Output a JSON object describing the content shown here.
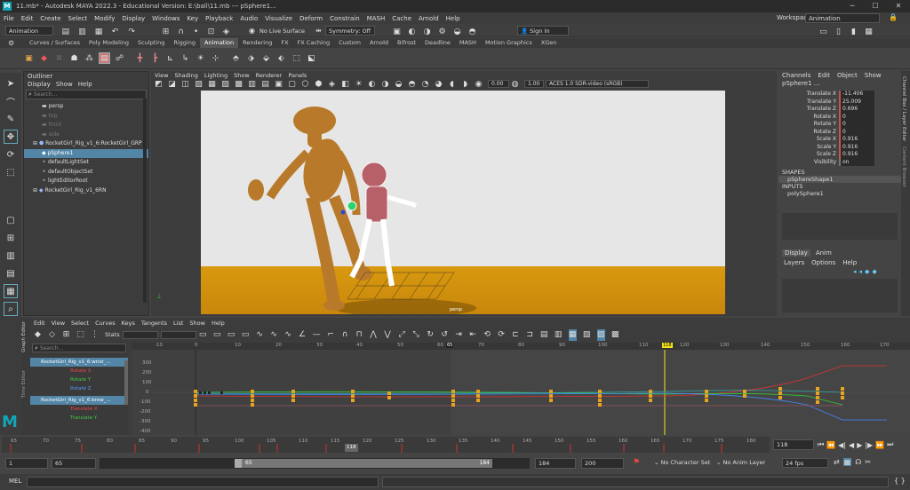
{
  "titlebar": {
    "title": "11.mb* - Autodesk MAYA 2022.3 - Educational Version: E:\\ball\\11.mb  ---  pSphere1...",
    "workspace_label": "Workspace :",
    "workspace_value": "Animation"
  },
  "menubar": {
    "items": [
      "File",
      "Edit",
      "Create",
      "Select",
      "Modify",
      "Display",
      "Windows",
      "Key",
      "Playback",
      "Audio",
      "Visualize",
      "Deform",
      "Constrain",
      "MASH",
      "Cache",
      "Arnold",
      "Help"
    ]
  },
  "statusline": {
    "mode": "Animation",
    "live_surface": "No Live Surface",
    "symmetry": "Symmetry: Off",
    "sign_in": "Sign In"
  },
  "shelf_tabs": {
    "items": [
      "Curves / Surfaces",
      "Poly Modeling",
      "Sculpting",
      "Rigging",
      "Animation",
      "Rendering",
      "FX",
      "FX Caching",
      "Custom",
      "Arnold",
      "Bifrost",
      "Deadline",
      "MASH",
      "Motion Graphics",
      "XGen"
    ],
    "active": "Animation"
  },
  "outliner": {
    "title": "Outliner",
    "menu": [
      "Display",
      "Show",
      "Help"
    ],
    "search_placeholder": "Search...",
    "items": [
      {
        "label": "persp",
        "state": "normal"
      },
      {
        "label": "top",
        "state": "dim"
      },
      {
        "label": "front",
        "state": "dim"
      },
      {
        "label": "side",
        "state": "dim"
      },
      {
        "label": "RocketGirl_Rig_v1_6:RocketGirl_GRP",
        "state": "normal"
      },
      {
        "label": "pSphere1",
        "state": "selected"
      },
      {
        "label": "defaultLightSet",
        "state": "normal"
      },
      {
        "label": "defaultObjectSet",
        "state": "normal"
      },
      {
        "label": "lightEditorRoot",
        "state": "normal"
      },
      {
        "label": "RocketGirl_Rig_v1_6RN",
        "state": "normal"
      }
    ]
  },
  "viewport": {
    "menu": [
      "View",
      "Shading",
      "Lighting",
      "Show",
      "Renderer",
      "Panels"
    ],
    "exposure": "0.00",
    "gamma": "1.00",
    "color_space": "ACES 1.0 SDR-video (sRGB)",
    "camera_label": "persp"
  },
  "channel_box": {
    "menu": [
      "Channels",
      "Edit",
      "Object",
      "Show"
    ],
    "object": "pSphere1 ...",
    "channels": [
      {
        "label": "Translate X",
        "value": "-11.406"
      },
      {
        "label": "Translate Y",
        "value": "25.009"
      },
      {
        "label": "Translate Z",
        "value": "0.696"
      },
      {
        "label": "Rotate X",
        "value": "0"
      },
      {
        "label": "Rotate Y",
        "value": "0"
      },
      {
        "label": "Rotate Z",
        "value": "0"
      },
      {
        "label": "Scale X",
        "value": "0.916"
      },
      {
        "label": "Scale Y",
        "value": "0.916"
      },
      {
        "label": "Scale Z",
        "value": "0.916"
      },
      {
        "label": "Visibility",
        "value": "on"
      }
    ],
    "shapes_header": "SHAPES",
    "shape": "pSphereShape1",
    "inputs_header": "INPUTS",
    "input": "polySphere1",
    "layer_tabs": [
      "Display",
      "Anim"
    ],
    "layer_menu": [
      "Layers",
      "Options",
      "Help"
    ],
    "side_tabs": [
      "Channel Box / Layer Editor",
      "Content Browser"
    ]
  },
  "graph_editor": {
    "menu": [
      "Edit",
      "View",
      "Select",
      "Curves",
      "Keys",
      "Tangents",
      "List",
      "Show",
      "Help"
    ],
    "stats_label": "Stats",
    "search_placeholder": "Search...",
    "side_label": "Graph Editor",
    "side_label2": "Time Editor",
    "curves": [
      {
        "label": "RocketGirl_Rig_v1_6:wrist_...",
        "type": "node"
      },
      {
        "label": "Rotate X",
        "type": "rx"
      },
      {
        "label": "Rotate Y",
        "type": "ry"
      },
      {
        "label": "Rotate Z",
        "type": "rz"
      },
      {
        "label": "RocketGirl_Rig_v1_6:brow_...",
        "type": "node"
      },
      {
        "label": "Translate X",
        "type": "rx"
      },
      {
        "label": "Translate Y",
        "type": "ry"
      }
    ],
    "y_ticks": [
      "300",
      "200",
      "100",
      "0",
      "-100",
      "-200",
      "-300",
      "-400"
    ],
    "x_ticks": [
      "-10",
      "0",
      "10",
      "20",
      "30",
      "40",
      "50",
      "60",
      "70",
      "80",
      "90",
      "100",
      "110",
      "120",
      "130",
      "140",
      "150",
      "160",
      "170"
    ],
    "current_frame_marker": "118",
    "range_marker": "65"
  },
  "timeslider": {
    "ticks": [
      "65",
      "70",
      "75",
      "80",
      "85",
      "90",
      "95",
      "100",
      "105",
      "110",
      "115",
      "120",
      "125",
      "130",
      "135",
      "140",
      "145",
      "150",
      "155",
      "160",
      "165",
      "170",
      "175",
      "180"
    ],
    "current_frame_label": "118",
    "current_frame_field": "118"
  },
  "range": {
    "start": "1",
    "playback_start": "65",
    "range_start_label": "65",
    "range_end_label": "184",
    "playback_end": "184",
    "end": "200",
    "character_set": "No Character Set",
    "anim_layer": "No Anim Layer",
    "fps": "24 fps"
  },
  "command_line": {
    "label": "MEL"
  }
}
